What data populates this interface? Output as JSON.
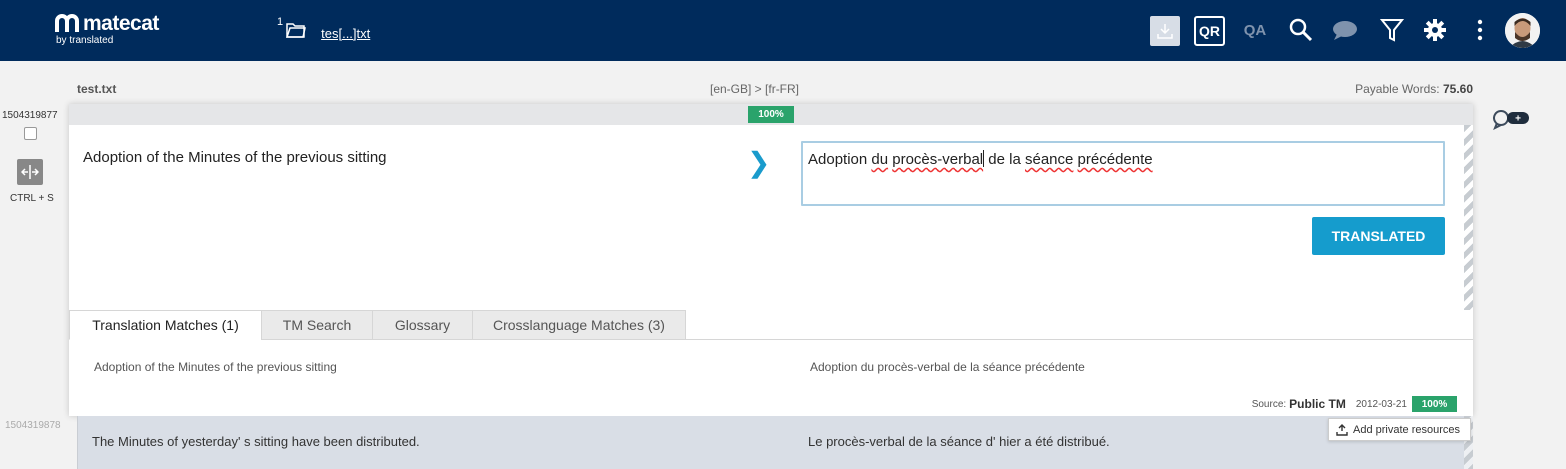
{
  "header": {
    "brand": "matecat",
    "byline": "by translated",
    "file_count": "1",
    "file_name": "tes[...]txt",
    "qr_label": "QR",
    "qa_label": "QA",
    "icons": [
      "download-icon",
      "search-icon",
      "comment-icon",
      "filter-icon",
      "gear-icon",
      "more-icon",
      "avatar"
    ]
  },
  "file_header": {
    "file_name": "test.txt",
    "language_pair": "[en-GB] > [fr-FR]",
    "payable_label": "Payable Words:",
    "payable_value": "75.60"
  },
  "gutter": {
    "segment_id": "1504319877",
    "shortcut": "CTRL + S",
    "next_segment_id": "1504319878"
  },
  "segment": {
    "match_badge": "100%",
    "source": "Adoption of the Minutes of the previous sitting",
    "target_parts": [
      "Adoption ",
      "du",
      " ",
      "procès-verbal",
      " de la ",
      "séance",
      " ",
      "précédente"
    ],
    "translated_button": "TRANSLATED"
  },
  "tabs": [
    {
      "label": "Translation Matches (1)",
      "active": true
    },
    {
      "label": "TM Search",
      "active": false
    },
    {
      "label": "Glossary",
      "active": false
    },
    {
      "label": "Crosslanguage Matches (3)",
      "active": false
    }
  ],
  "match": {
    "source": "Adoption of the Minutes of the previous sitting",
    "target": "Adoption du procès-verbal de la séance précédente",
    "source_label": "Source:",
    "source_value": "Public TM",
    "date": "2012-03-21",
    "percent": "100%"
  },
  "next_segment": {
    "source": "The Minutes of yesterday' s sitting have been distributed.",
    "target": "Le procès-verbal de la séance d' hier a été distribué."
  },
  "add_resources": "Add private resources",
  "comment_plus": "+"
}
